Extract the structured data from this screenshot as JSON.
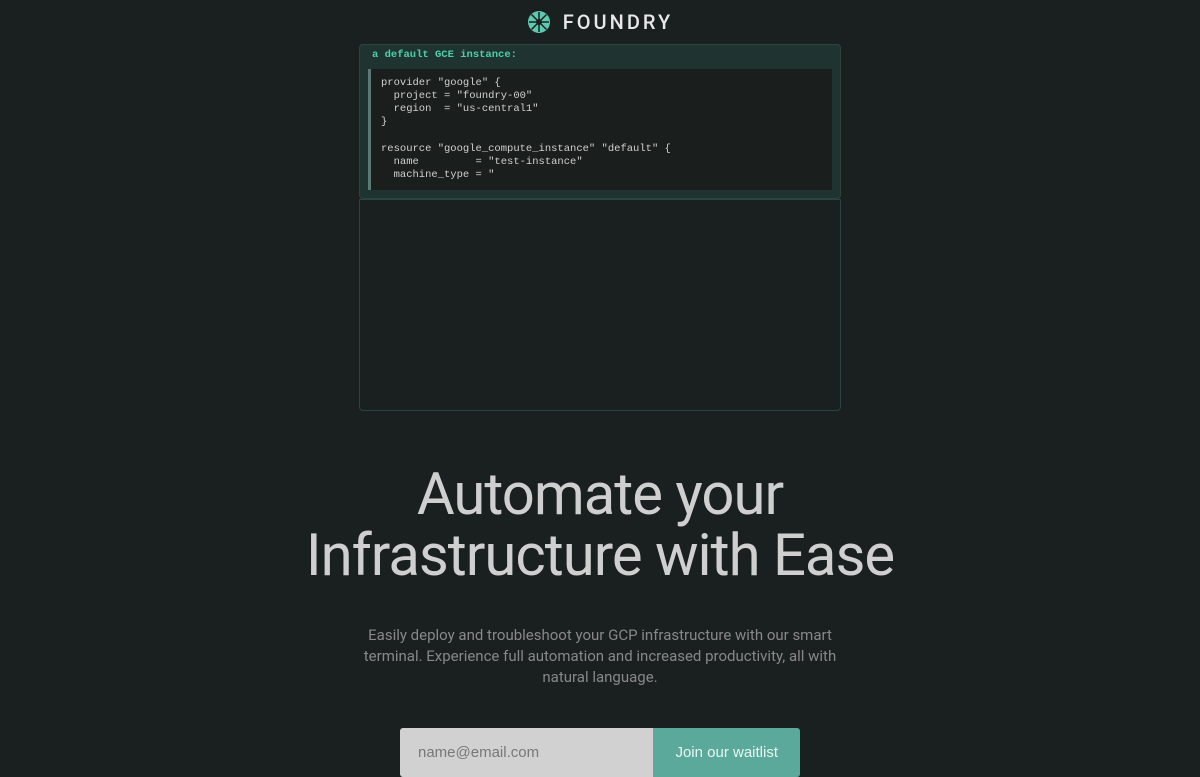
{
  "header": {
    "brand": "FOUNDRY"
  },
  "terminal": {
    "prompt": "a default GCE instance:",
    "code": "provider \"google\" {\n  project = \"foundry-00\"\n  region  = \"us-central1\"\n}\n\nresource \"google_compute_instance\" \"default\" {\n  name         = \"test-instance\"\n  machine_type = \""
  },
  "hero": {
    "title_line1": "Automate your",
    "title_line2": "Infrastructure with Ease",
    "subtitle": "Easily deploy and troubleshoot your GCP infrastructure with our smart terminal. Experience full automation and increased productivity, all with natural language."
  },
  "form": {
    "placeholder": "name@email.com",
    "button_label": "Join our waitlist"
  }
}
